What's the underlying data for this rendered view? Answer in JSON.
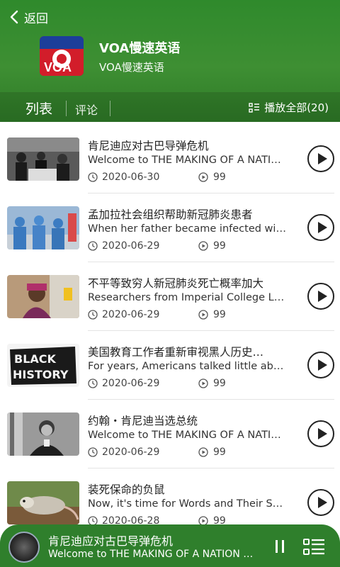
{
  "header": {
    "back_label": "返回",
    "album_title": "VOA慢速英语",
    "album_subtitle": "VOA慢速英语",
    "cover_text": "VOA"
  },
  "tabs": {
    "list_label": "列表",
    "comment_label": "评论",
    "play_all_label": "播放全部(20)"
  },
  "items": [
    {
      "title": "肯尼迪应对古巴导弹危机",
      "desc": "Welcome to THE MAKING OF A NATI…",
      "date": "2020-06-30",
      "plays": "99"
    },
    {
      "title": "孟加拉社会组织帮助新冠肺炎患者",
      "desc": "When her father became infected wi…",
      "date": "2020-06-29",
      "plays": "99"
    },
    {
      "title": "不平等致穷人新冠肺炎死亡概率加大",
      "desc": "Researchers from Imperial College L…",
      "date": "2020-06-29",
      "plays": "99"
    },
    {
      "title": "美国教育工作者重新审视黑人历史…",
      "desc": "For years, Americans talked little ab…",
      "date": "2020-06-29",
      "plays": "99"
    },
    {
      "title": "约翰・肯尼迪当选总统",
      "desc": "Welcome to THE MAKING OF A NATI…",
      "date": "2020-06-29",
      "plays": "99"
    },
    {
      "title": "装死保命的负鼠",
      "desc": "Now, it's time for Words and Their S…",
      "date": "2020-06-28",
      "plays": "99"
    }
  ],
  "thumb4_text": [
    "BLACK",
    "HISTORY"
  ],
  "player": {
    "title": "肯尼迪应对古巴导弹危机",
    "desc": "Welcome to THE MAKING OF A NATION …"
  },
  "colors": {
    "header_green": "#3e8f33",
    "player_green": "#2f7f2c"
  }
}
